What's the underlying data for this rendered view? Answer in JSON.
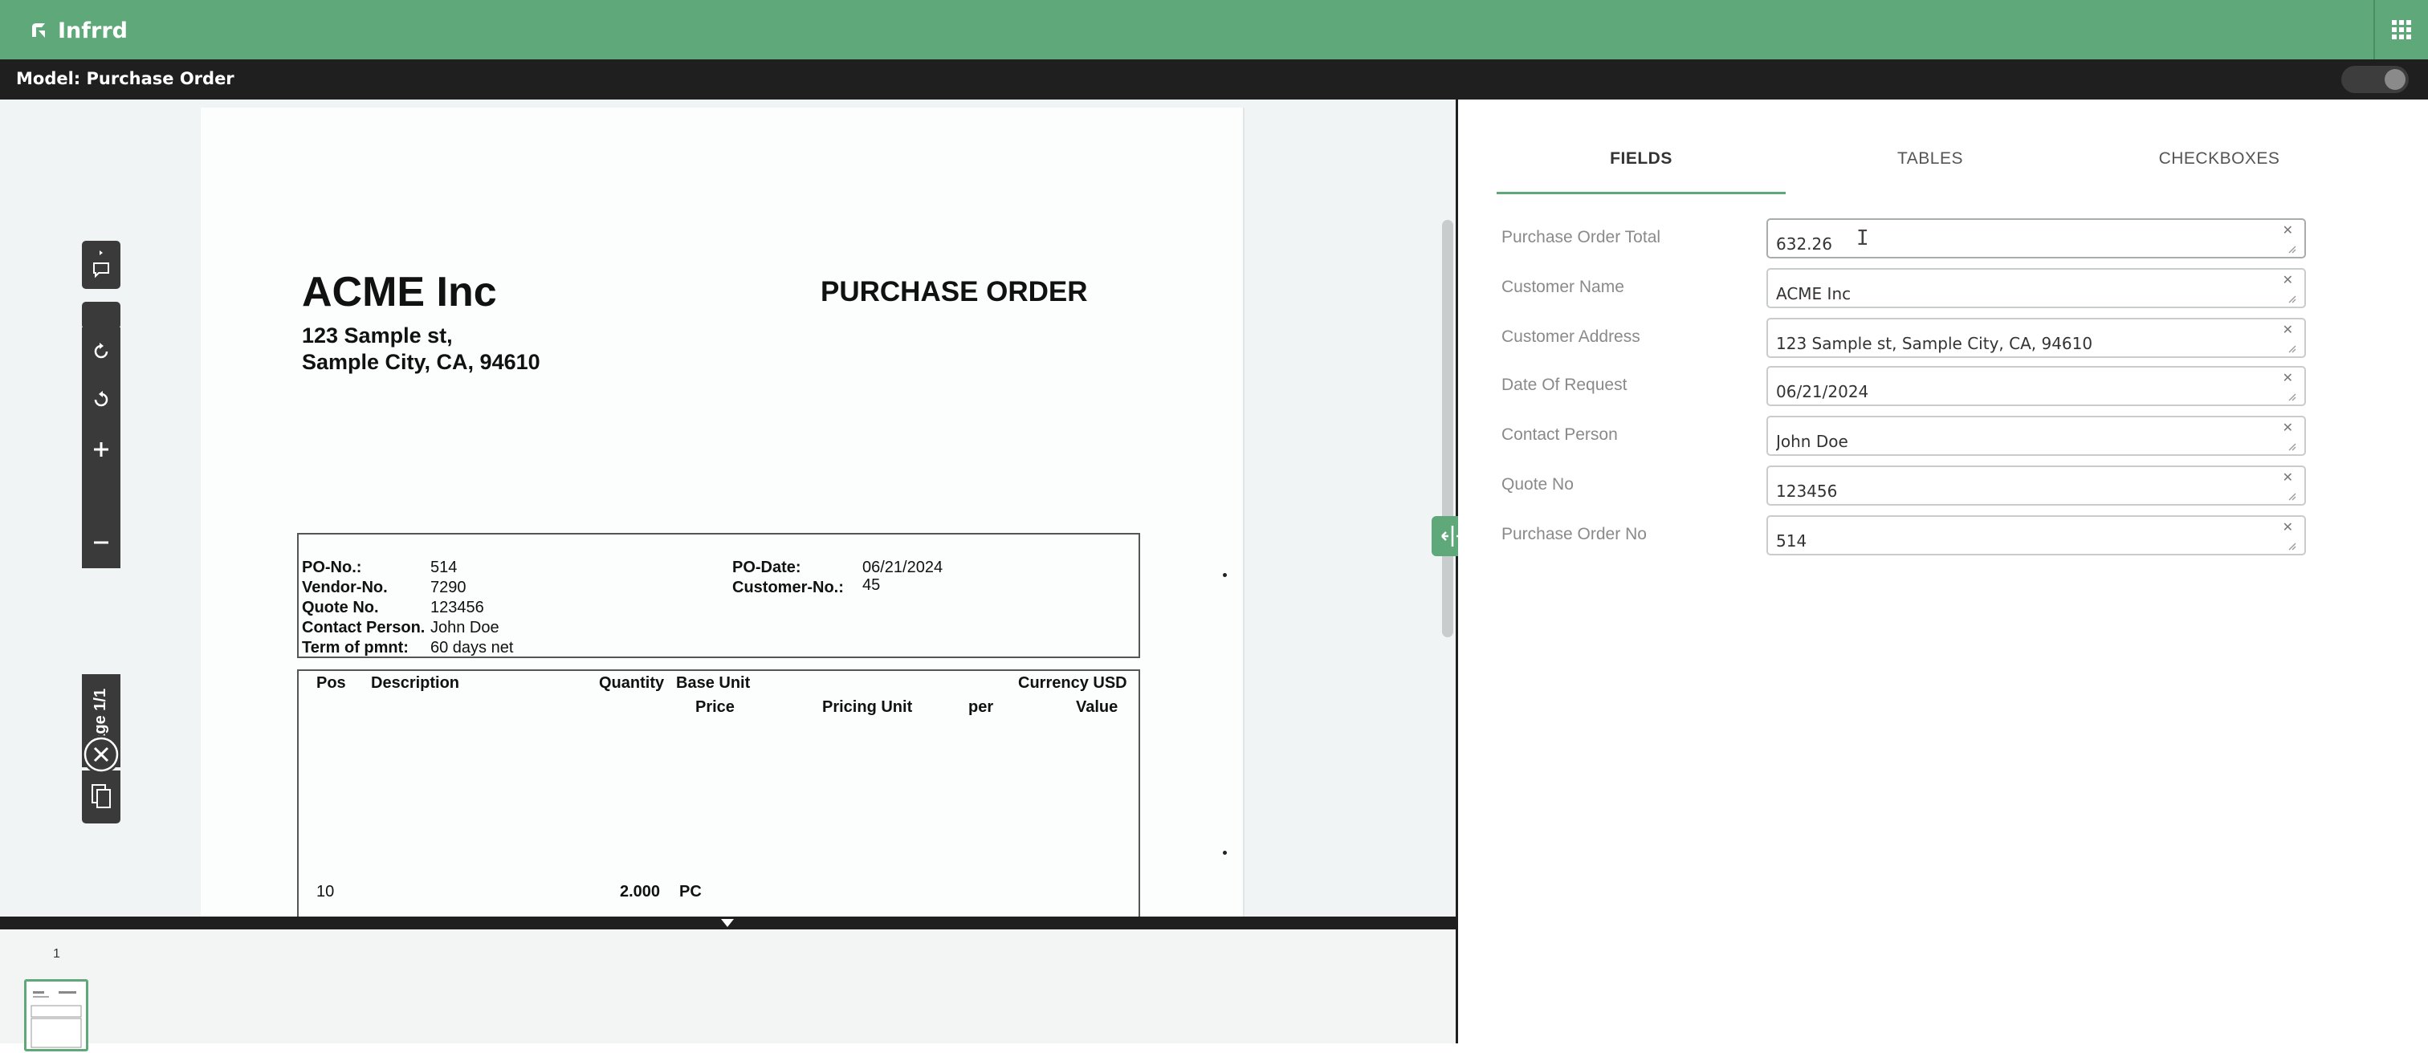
{
  "app": {
    "brand": "Infrrd",
    "colors": {
      "accent": "#5fa87a",
      "dark": "#1f1f1f"
    }
  },
  "header": {
    "model_title": "Model: Purchase Order"
  },
  "document": {
    "company_name": "ACME Inc",
    "address_line1": "123 Sample st,",
    "address_line2": "Sample City, CA, 94610",
    "doc_title": "PURCHASE ORDER",
    "info_left": [
      {
        "label": "PO-No.:",
        "value": "514"
      },
      {
        "label": "Vendor-No.",
        "value": "7290"
      },
      {
        "label": "Quote No.",
        "value": "123456"
      },
      {
        "label": "Contact Person.",
        "value": "John Doe"
      },
      {
        "label": "Term of pmnt:",
        "value": "60 days net"
      }
    ],
    "info_right": [
      {
        "label": "PO-Date:",
        "value": "06/21/2024"
      },
      {
        "label": "Customer-No.:",
        "value": "45"
      }
    ],
    "table_headers": {
      "pos": "Pos",
      "description": "Description",
      "quantity": "Quantity",
      "base_unit": "Base Unit",
      "price": "Price",
      "pricing_unit": "Pricing Unit",
      "per": "per",
      "currency": "Currency USD",
      "value": "Value"
    },
    "row": {
      "pos": "10",
      "quantity": "2.000",
      "unit": "PC"
    }
  },
  "viewer": {
    "page_indicator": "Page 1/1",
    "thumbnail_page": "1"
  },
  "tabs": [
    {
      "label": "FIELDS",
      "active": true
    },
    {
      "label": "TABLES",
      "active": false
    },
    {
      "label": "CHECKBOXES",
      "active": false
    }
  ],
  "fields": [
    {
      "label": "Purchase Order Total",
      "value": "632.26"
    },
    {
      "label": "Customer Name",
      "value": "ACME Inc"
    },
    {
      "label": "Customer Address",
      "value": "123 Sample st, Sample City, CA, 94610"
    },
    {
      "label": "Date Of Request",
      "value": "06/21/2024"
    },
    {
      "label": "Contact Person",
      "value": "John Doe"
    },
    {
      "label": "Quote No",
      "value": "123456"
    },
    {
      "label": "Purchase Order No",
      "value": "514"
    }
  ]
}
